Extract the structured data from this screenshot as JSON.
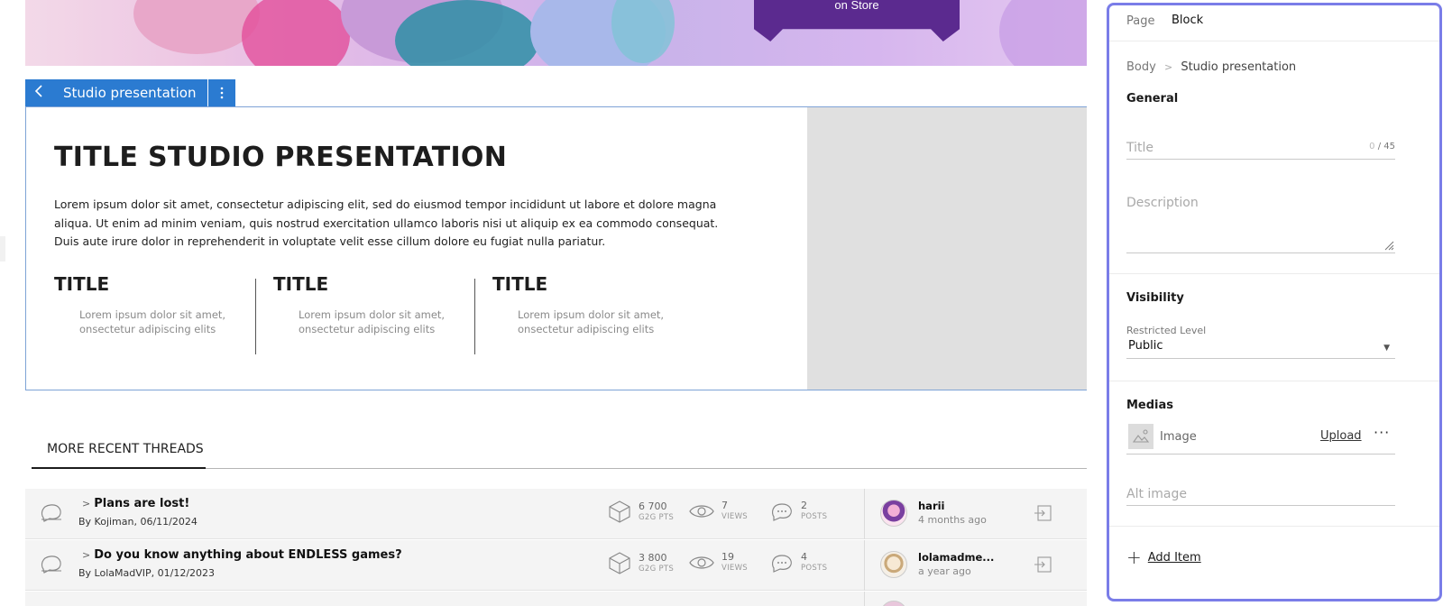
{
  "banner": {
    "store_text": "on Store"
  },
  "block_toolbar": {
    "label": "Studio presentation"
  },
  "presentation": {
    "title": "TITLE STUDIO PRESENTATION",
    "body": "Lorem ipsum dolor sit amet, consectetur adipiscing elit, sed do eiusmod tempor incididunt ut labore et dolore magna aliqua. Ut enim ad minim veniam, quis nostrud exercitation ullamco laboris nisi ut aliquip ex ea commodo consequat. Duis aute irure dolor in reprehenderit in voluptate velit esse cillum dolore eu fugiat nulla pariatur.",
    "columns": [
      {
        "title": "TITLE",
        "text": "Lorem ipsum dolor sit amet, onsectetur adipiscing elits"
      },
      {
        "title": "TITLE",
        "text": "Lorem ipsum dolor sit amet, onsectetur adipiscing elits"
      },
      {
        "title": "TITLE",
        "text": "Lorem ipsum dolor sit amet, onsectetur adipiscing elits"
      }
    ]
  },
  "threads": {
    "tab": "MORE RECENT THREADS",
    "items": [
      {
        "title": "Plans are lost!",
        "by": "By Kojiman, 06/11/2024",
        "points": "6 700",
        "points_label": "G2G PTS",
        "views": "7",
        "views_label": "VIEWS",
        "posts": "2",
        "posts_label": "POSTS",
        "user": "harii",
        "ago": "4 months ago"
      },
      {
        "title": "Do you know anything about ENDLESS games?",
        "by": "By LolaMadVIP, 01/12/2023",
        "points": "3 800",
        "points_label": "G2G PTS",
        "views": "19",
        "views_label": "VIEWS",
        "posts": "4",
        "posts_label": "POSTS",
        "user": "lolamadme...",
        "ago": "a year ago"
      }
    ]
  },
  "panel": {
    "tab_page": "Page",
    "tab_block": "Block",
    "crumb_root": "Body",
    "crumb_current": "Studio presentation",
    "general": "General",
    "title_placeholder": "Title",
    "title_count": "0",
    "title_max": "/ 45",
    "description_placeholder": "Description",
    "visibility": "Visibility",
    "restricted_label": "Restricted Level",
    "restricted_value": "Public",
    "medias": "Medias",
    "image_label": "Image",
    "upload": "Upload",
    "alt_placeholder": "Alt image",
    "add_item": "Add Item"
  },
  "colors": {
    "accent": "#2b7bd1",
    "panel_border": "#7a7de8"
  }
}
